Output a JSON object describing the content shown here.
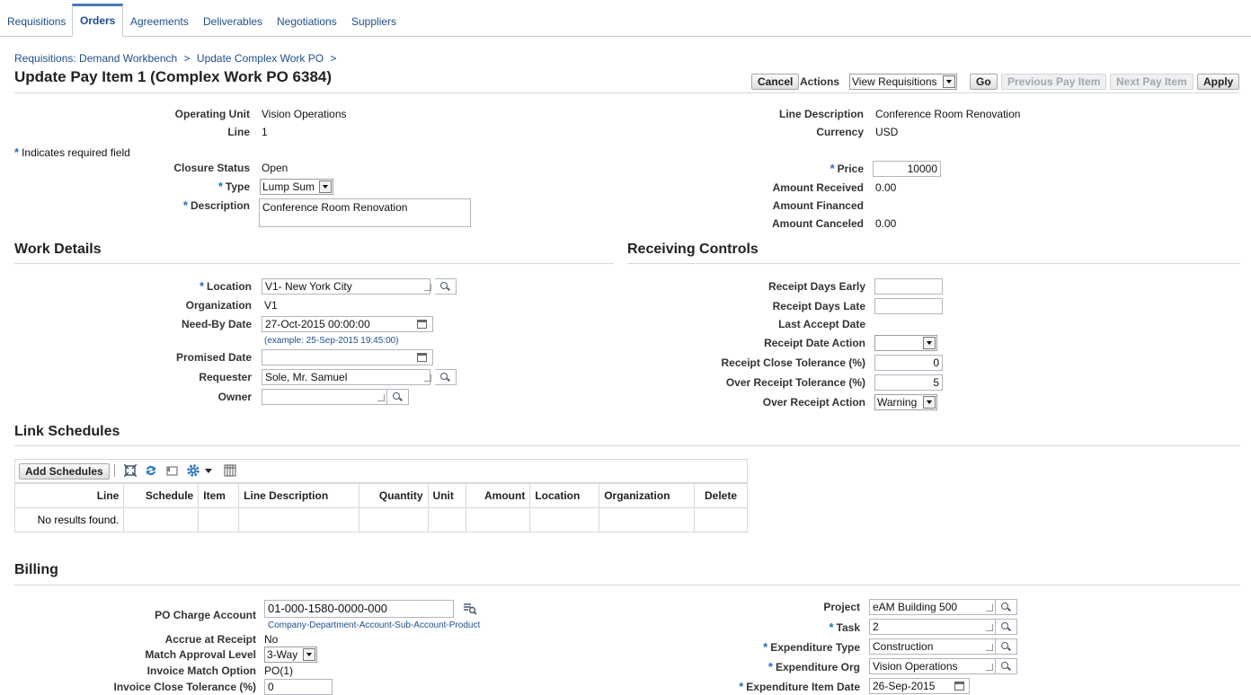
{
  "tabs": [
    "Requisitions",
    "Orders",
    "Agreements",
    "Deliverables",
    "Negotiations",
    "Suppliers"
  ],
  "breadcrumb": {
    "item1": "Requisitions: Demand Workbench",
    "sep": ">",
    "item2": "Update Complex Work PO"
  },
  "page_title": "Update Pay Item 1 (Complex Work PO 6384)",
  "actions": {
    "cancel": "Cancel",
    "actions_label": "Actions",
    "select_value": "View Requisitions",
    "go": "Go",
    "previous": "Previous Pay Item",
    "next": "Next Pay Item",
    "apply": "Apply"
  },
  "header": {
    "operating_unit_label": "Operating Unit",
    "operating_unit": "Vision Operations",
    "line_label": "Line",
    "line": "1",
    "required_note": "Indicates required field",
    "closure_status_label": "Closure Status",
    "closure_status": "Open",
    "type_label": "Type",
    "type": "Lump Sum",
    "description_label": "Description",
    "description": "Conference Room Renovation",
    "line_description_label": "Line Description",
    "line_description": "Conference Room Renovation",
    "currency_label": "Currency",
    "currency": "USD",
    "price_label": "Price",
    "price": "10000",
    "amount_received_label": "Amount Received",
    "amount_received": "0.00",
    "amount_financed_label": "Amount Financed",
    "amount_canceled_label": "Amount Canceled",
    "amount_canceled": "0.00"
  },
  "work_details": {
    "title": "Work Details",
    "location_label": "Location",
    "location": "V1- New York City",
    "organization_label": "Organization",
    "organization": "V1",
    "need_by_label": "Need-By Date",
    "need_by": "27-Oct-2015 00:00:00",
    "need_by_hint": "(example: 25-Sep-2015 19:45:00)",
    "promised_label": "Promised Date",
    "requester_label": "Requester",
    "requester": "Sole, Mr. Samuel",
    "owner_label": "Owner"
  },
  "receiving": {
    "title": "Receiving Controls",
    "early_label": "Receipt Days Early",
    "late_label": "Receipt Days Late",
    "last_accept_label": "Last Accept Date",
    "date_action_label": "Receipt Date Action",
    "close_tol_label": "Receipt Close Tolerance (%)",
    "close_tol": "0",
    "over_tol_label": "Over Receipt Tolerance (%)",
    "over_tol": "5",
    "over_action_label": "Over Receipt Action",
    "over_action": "Warning"
  },
  "link_schedules": {
    "title": "Link Schedules",
    "add_button": "Add Schedules",
    "columns": [
      "Line",
      "Schedule",
      "Item",
      "Line Description",
      "Quantity",
      "Unit",
      "Amount",
      "Location",
      "Organization",
      "Delete"
    ],
    "empty": "No results found."
  },
  "billing": {
    "title": "Billing",
    "charge_label": "PO Charge Account",
    "charge": "01-000-1580-0000-000",
    "charge_hint": "Company-Department-Account-Sub-Account-Product",
    "accrue_label": "Accrue at Receipt",
    "accrue": "No",
    "match_label": "Match Approval Level",
    "match": "3-Way",
    "invoice_match_label": "Invoice Match Option",
    "invoice_match": "PO(1)",
    "invoice_close_label": "Invoice Close Tolerance (%)",
    "invoice_close": "0",
    "project_label": "Project",
    "project": "eAM Building 500",
    "task_label": "Task",
    "task": "2",
    "exp_type_label": "Expenditure Type",
    "exp_type": "Construction",
    "exp_org_label": "Expenditure Org",
    "exp_org": "Vision Operations",
    "exp_date_label": "Expenditure Item Date",
    "exp_date": "26-Sep-2015"
  },
  "colors": {
    "link": "#1f4e8c",
    "required": "#2a6ac4",
    "rule": "#d6d8de"
  }
}
